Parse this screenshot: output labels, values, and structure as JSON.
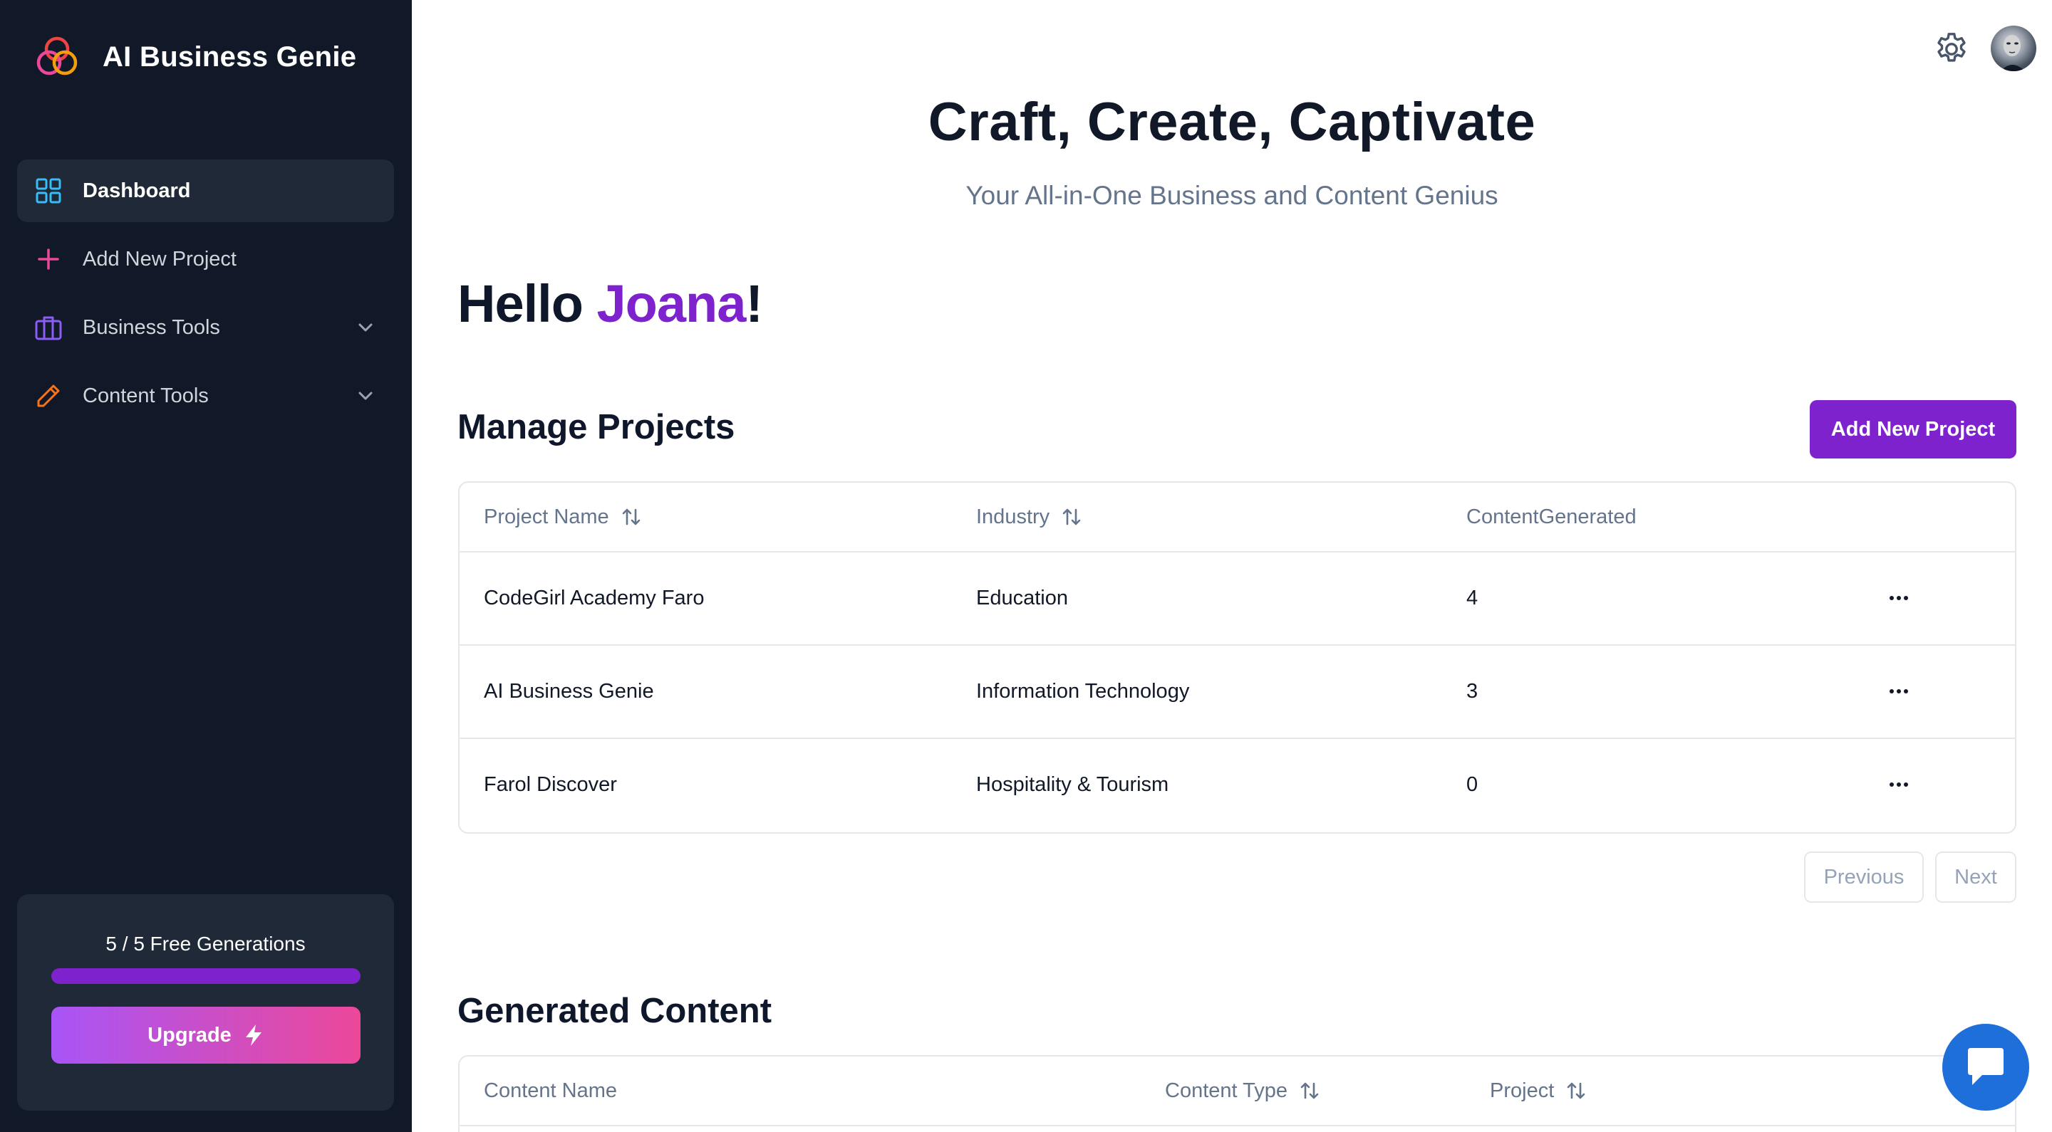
{
  "brand": {
    "name": "AI Business Genie"
  },
  "sidebar": {
    "items": [
      {
        "label": "Dashboard",
        "active": true
      },
      {
        "label": "Add New Project"
      },
      {
        "label": "Business Tools",
        "expandable": true
      },
      {
        "label": "Content Tools",
        "expandable": true
      }
    ],
    "usage": {
      "text": "5 / 5 Free Generations",
      "used": 5,
      "total": 5
    },
    "upgrade_label": "Upgrade"
  },
  "hero": {
    "title": "Craft, Create, Captivate",
    "subtitle": "Your All-in-One Business and Content Genius"
  },
  "greeting": {
    "prefix": "Hello ",
    "name": "Joana",
    "suffix": "!"
  },
  "projects": {
    "title": "Manage Projects",
    "add_label": "Add New Project",
    "columns": [
      "Project Name",
      "Industry",
      "ContentGenerated"
    ],
    "rows": [
      {
        "name": "CodeGirl Academy Faro",
        "industry": "Education",
        "content": "4"
      },
      {
        "name": "AI Business Genie",
        "industry": "Information Technology",
        "content": "3"
      },
      {
        "name": "Farol Discover",
        "industry": "Hospitality & Tourism",
        "content": "0"
      }
    ],
    "pager": {
      "previous": "Previous",
      "next": "Next"
    }
  },
  "content": {
    "title": "Generated Content",
    "columns": [
      "Content Name",
      "Content Type",
      "Project"
    ]
  },
  "colors": {
    "accent": "#7e22ce",
    "sidebar": "#111827",
    "chat": "#1e6fd9"
  }
}
